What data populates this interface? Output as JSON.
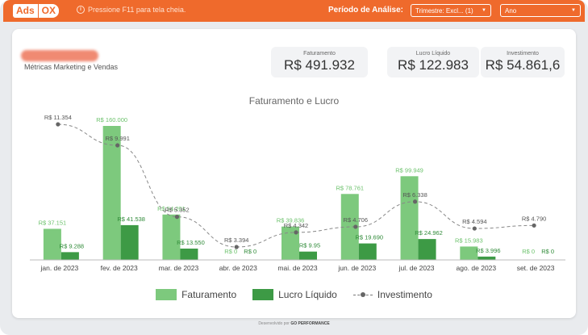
{
  "topbar": {
    "logo_ads": "Ads",
    "logo_ox": "OX",
    "hint": "Pressione F11 para tela cheia.",
    "period_label": "Período de Análise:",
    "trimestre_select": "Trimestre: Excl... (1)",
    "ano_select": "Ano"
  },
  "header": {
    "subtitle": "Métricas Marketing e Vendas"
  },
  "kpis": {
    "faturamento_label": "Faturamento",
    "faturamento_value": "R$ 491.932",
    "lucro_label": "Lucro Líquido",
    "lucro_value": "R$ 122.983",
    "investimento_label": "Investimento",
    "investimento_value": "R$ 54.861,6"
  },
  "chart_data": {
    "type": "bar",
    "title": "Faturamento e Lucro",
    "categories": [
      "jan. de 2023",
      "fev. de 2023",
      "mar. de 2023",
      "abr. de 2023",
      "mai. de 2023",
      "jun. de 2023",
      "jul. de 2023",
      "ago. de 2023",
      "set. de 2023"
    ],
    "series": [
      {
        "name": "Faturamento",
        "type": "bar",
        "color": "#7dc97d",
        "values": [
          37151,
          160000,
          54201,
          0,
          39836,
          78761,
          99949,
          15983,
          0
        ],
        "labels": [
          "R$ 37.151",
          "R$ 160.000",
          "R$ 54.201",
          "R$ 0",
          "R$ 39.836",
          "R$ 78.761",
          "R$ 99.949",
          "R$ 15.983",
          "R$ 0"
        ]
      },
      {
        "name": "Lucro Líquido",
        "type": "bar",
        "color": "#3d9a45",
        "values": [
          9288,
          41538,
          13550,
          0,
          9950,
          19690,
          24962,
          3996,
          0
        ],
        "labels": [
          "R$ 9.288",
          "R$ 41.538",
          "R$ 13.550",
          "R$ 0",
          "R$ 9.95",
          "R$ 19.690",
          "R$ 24.962",
          "R$ 3.996",
          "R$ 0"
        ]
      },
      {
        "name": "Investimento",
        "type": "line",
        "color": "#666666",
        "values": [
          11354,
          9991,
          5352,
          3394,
          4342,
          4706,
          6338,
          4594,
          4790
        ],
        "labels": [
          "R$ 11.354",
          "R$ 9.991",
          "R$ 5.352",
          "R$ 3.394",
          "R$ 4.342",
          "R$ 4.706",
          "R$ 6.338",
          "R$ 4.594",
          "R$ 4.790"
        ]
      }
    ],
    "legend_position": "bottom",
    "grid": false
  },
  "footer": {
    "prefix": "Desenvolvido por",
    "brand": "GO PERFORMANCE"
  }
}
